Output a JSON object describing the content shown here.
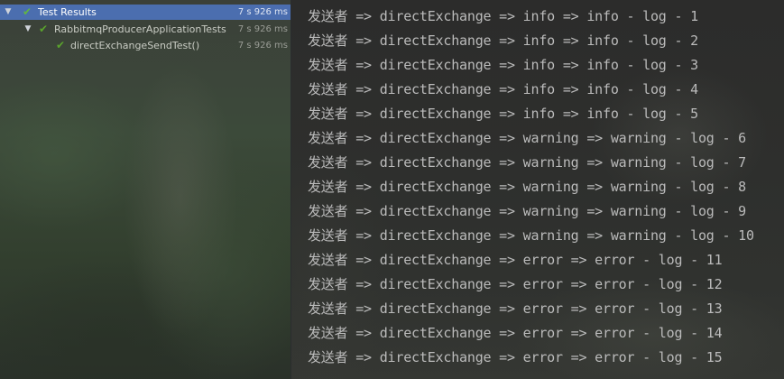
{
  "test_tree": {
    "rows": [
      {
        "label": "Test Results",
        "duration": "7 s 926 ms",
        "expand_icon": "chevron-down-icon",
        "status_icon": "check-icon",
        "status_color": "#5aa32d"
      },
      {
        "label": "RabbitmqProducerApplicationTests",
        "duration": "7 s 926 ms",
        "expand_icon": "chevron-down-icon",
        "status_icon": "check-icon",
        "status_color": "#5aa32d"
      },
      {
        "label": "directExchangeSendTest()",
        "duration": "7 s 926 ms",
        "status_icon": "check-icon",
        "status_color": "#5aa32d"
      }
    ],
    "selected_color": "#4b6eaf"
  },
  "console": {
    "lines": [
      "发送者 => directExchange => info => info - log - 1",
      "发送者 => directExchange => info => info - log - 2",
      "发送者 => directExchange => info => info - log - 3",
      "发送者 => directExchange => info => info - log - 4",
      "发送者 => directExchange => info => info - log - 5",
      "发送者 => directExchange => warning => warning - log - 6",
      "发送者 => directExchange => warning => warning - log - 7",
      "发送者 => directExchange => warning => warning - log - 8",
      "发送者 => directExchange => warning => warning - log - 9",
      "发送者 => directExchange => warning => warning - log - 10",
      "发送者 => directExchange => error => error - log - 11",
      "发送者 => directExchange => error => error - log - 12",
      "发送者 => directExchange => error => error - log - 13",
      "发送者 => directExchange => error => error - log - 14",
      "发送者 => directExchange => error => error - log - 15"
    ],
    "text_color": "#bbbbbb"
  }
}
